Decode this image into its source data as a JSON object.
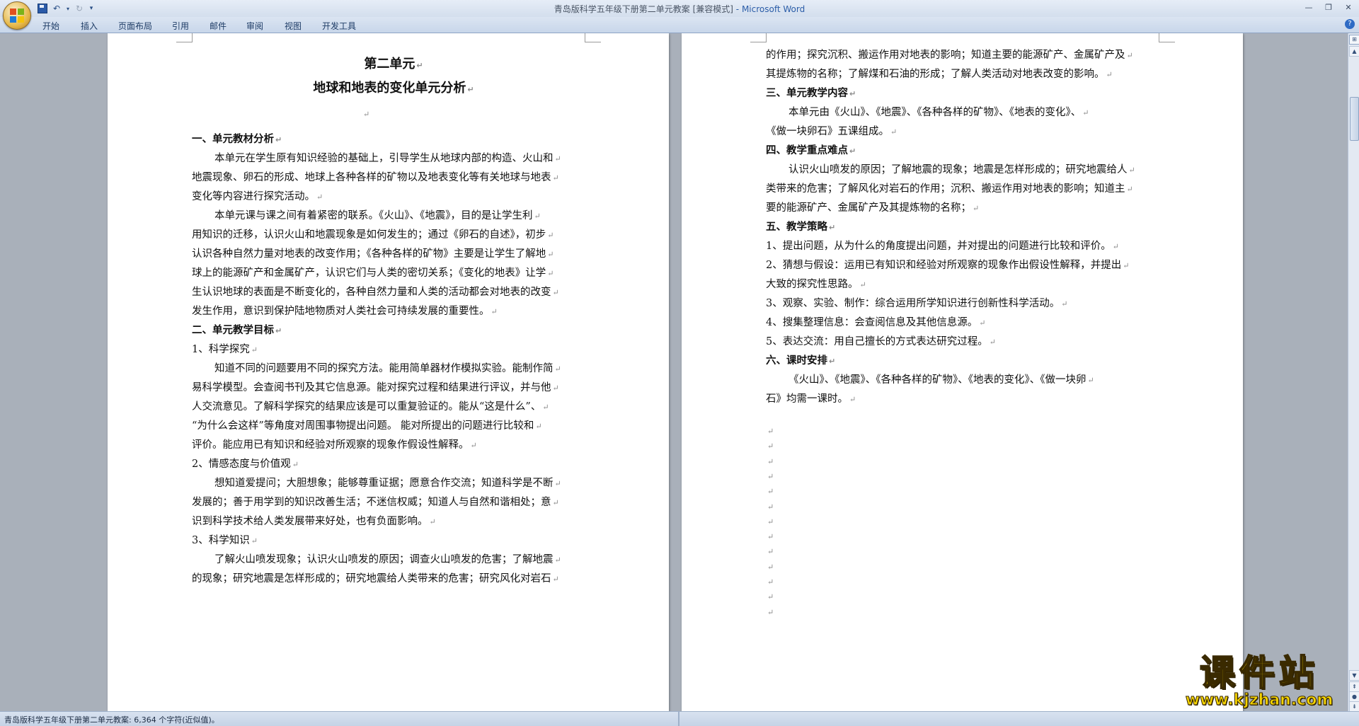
{
  "window": {
    "doc_title": "青岛版科学五年级下册第二单元教案 [兼容模式]",
    "app_name": "- Microsoft Word"
  },
  "ribbon": {
    "tabs": [
      "开始",
      "插入",
      "页面布局",
      "引用",
      "邮件",
      "审阅",
      "视图",
      "开发工具"
    ]
  },
  "page1": {
    "title_line1": "第二单元",
    "title_line2": "地球和地表的变化单元分析",
    "lines": [
      {
        "t": "一、单元教材分析",
        "k": "hd"
      },
      {
        "t": "本单元在学生原有知识经验的基础上，引导学生从地球内部的构造、火山和",
        "k": "ind"
      },
      {
        "t": "地震现象、卵石的形成、地球上各种各样的矿物以及地表变化等有关地球与地表",
        "k": ""
      },
      {
        "t": "变化等内容进行探究活动。",
        "k": ""
      },
      {
        "t": "本单元课与课之间有着紧密的联系。《火山》、《地震》，目的是让学生利",
        "k": "ind"
      },
      {
        "t": "用知识的迁移，认识火山和地震现象是如何发生的；通过《卵石的自述》，初步",
        "k": ""
      },
      {
        "t": "认识各种自然力量对地表的改变作用；《各种各样的矿物》主要是让学生了解地",
        "k": ""
      },
      {
        "t": "球上的能源矿产和金属矿产，认识它们与人类的密切关系；《变化的地表》让学",
        "k": ""
      },
      {
        "t": "生认识地球的表面是不断变化的，各种自然力量和人类的活动都会对地表的改变",
        "k": ""
      },
      {
        "t": "发生作用，意识到保护陆地物质对人类社会可持续发展的重要性。",
        "k": ""
      },
      {
        "t": "二、单元教学目标",
        "k": "hd"
      },
      {
        "t": "1、科学探究",
        "k": ""
      },
      {
        "t": "知道不同的问题要用不同的探究方法。能用简单器材作模拟实验。能制作简",
        "k": "ind"
      },
      {
        "t": "易科学模型。会查阅书刊及其它信息源。能对探究过程和结果进行评议，并与他",
        "k": ""
      },
      {
        "t": "人交流意见。了解科学探究的结果应该是可以重复验证的。能从“这是什么”、",
        "k": ""
      },
      {
        "t": "“为什么会这样”等角度对周围事物提出问题。  能对所提出的问题进行比较和",
        "k": ""
      },
      {
        "t": "评价。能应用已有知识和经验对所观察的现象作假设性解释。",
        "k": ""
      },
      {
        "t": "2、情感态度与价值观",
        "k": ""
      },
      {
        "t": "想知道爱提问；大胆想象；能够尊重证据；愿意合作交流；知道科学是不断",
        "k": "ind"
      },
      {
        "t": "发展的；善于用学到的知识改善生活；不迷信权威；知道人与自然和谐相处；意",
        "k": ""
      },
      {
        "t": "识到科学技术给人类发展带来好处，也有负面影响。",
        "k": ""
      },
      {
        "t": "3、科学知识",
        "k": ""
      },
      {
        "t": "了解火山喷发现象；认识火山喷发的原因；调查火山喷发的危害；了解地震",
        "k": "ind"
      },
      {
        "t": "的现象；研究地震是怎样形成的；研究地震给人类带来的危害；研究风化对岩石",
        "k": ""
      }
    ]
  },
  "page2": {
    "lines": [
      {
        "t": "的作用；探究沉积、搬运作用对地表的影响；知道主要的能源矿产、金属矿产及",
        "k": ""
      },
      {
        "t": "其提炼物的名称；了解煤和石油的形成；了解人类活动对地表改变的影响。",
        "k": ""
      },
      {
        "t": "三、单元教学内容",
        "k": "hd"
      },
      {
        "t": "本单元由《火山》、《地震》、《各种各样的矿物》、《地表的变化》、",
        "k": "ind"
      },
      {
        "t": "《做一块卵石》五课组成。",
        "k": ""
      },
      {
        "t": "四、教学重点难点",
        "k": "hd"
      },
      {
        "t": "认识火山喷发的原因；了解地震的现象；地震是怎样形成的；研究地震给人",
        "k": "ind"
      },
      {
        "t": "类带来的危害；了解风化对岩石的作用；沉积、搬运作用对地表的影响；知道主",
        "k": ""
      },
      {
        "t": "要的能源矿产、金属矿产及其提炼物的名称；",
        "k": ""
      },
      {
        "t": "五、教学策略",
        "k": "hd"
      },
      {
        "t": "1、提出问题，从为什么的角度提出问题，并对提出的问题进行比较和评价。",
        "k": ""
      },
      {
        "t": "2、猜想与假设：运用已有知识和经验对所观察的现象作出假设性解释，并提出",
        "k": ""
      },
      {
        "t": "大致的探究性思路。",
        "k": ""
      },
      {
        "t": "3、观察、实验、制作：综合运用所学知识进行创新性科学活动。",
        "k": ""
      },
      {
        "t": "4、搜集整理信息：会查阅信息及其他信息源。",
        "k": ""
      },
      {
        "t": "5、表达交流：用自己擅长的方式表达研究过程。",
        "k": ""
      },
      {
        "t": "六、课时安排",
        "k": "hd"
      },
      {
        "t": "《火山》、《地震》、《各种各样的矿物》、《地表的变化》、《做一块卵",
        "k": "ind"
      },
      {
        "t": "石》均需一课时。",
        "k": ""
      }
    ],
    "empty_para_count": 13
  },
  "paragraph_mark": "↵",
  "status_bar": {
    "text": "青岛版科学五年级下册第二单元教案: 6,364 个字符(近似值)。"
  },
  "watermark": {
    "main": "课件站",
    "url": "www.kjzhan.com"
  }
}
